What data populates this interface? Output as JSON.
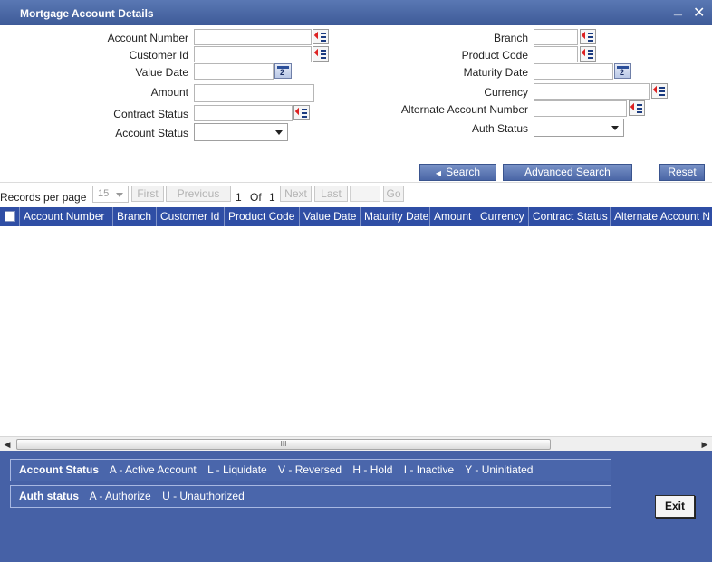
{
  "window": {
    "title": "Mortgage Account Details",
    "minimize": "_",
    "close": "✕"
  },
  "form": {
    "account_number": {
      "label": "Account Number",
      "value": ""
    },
    "customer_id": {
      "label": "Customer Id",
      "value": ""
    },
    "value_date": {
      "label": "Value Date",
      "value": ""
    },
    "amount": {
      "label": "Amount",
      "value": ""
    },
    "contract_status": {
      "label": "Contract Status",
      "value": ""
    },
    "account_status": {
      "label": "Account Status",
      "value": ""
    },
    "branch": {
      "label": "Branch",
      "value": ""
    },
    "product_code": {
      "label": "Product Code",
      "value": ""
    },
    "maturity_date": {
      "label": "Maturity Date",
      "value": ""
    },
    "currency": {
      "label": "Currency",
      "value": ""
    },
    "alternate_account_number": {
      "label": "Alternate Account Number",
      "value": ""
    },
    "auth_status": {
      "label": "Auth Status",
      "value": ""
    },
    "calendar_glyph": "2"
  },
  "actions": {
    "search": "Search",
    "advanced_search": "Advanced Search",
    "reset": "Reset"
  },
  "pager": {
    "records_per_page_label": "Records per page",
    "records_per_page": "15",
    "first": "First",
    "previous": "Previous",
    "current_page": "1",
    "of_label": "Of",
    "total_pages": "1",
    "next": "Next",
    "last": "Last",
    "go": "Go"
  },
  "grid": {
    "columns": [
      "Account Number",
      "Branch",
      "Customer Id",
      "Product Code",
      "Value Date",
      "Maturity Date",
      "Amount",
      "Currency",
      "Contract Status",
      "Alternate Account N"
    ]
  },
  "scrollbar": {
    "grip": "III"
  },
  "legend": {
    "account_status": {
      "title": "Account Status",
      "items": [
        "A - Active Account",
        "L - Liquidate",
        "V - Reversed",
        "H - Hold",
        "I - Inactive",
        "Y - Uninitiated"
      ]
    },
    "auth_status": {
      "title": "Auth status",
      "items": [
        "A - Authorize",
        "U - Unauthorized"
      ]
    }
  },
  "exit_label": "Exit",
  "colors": {
    "titlebar": "#3e5a98",
    "grid_header": "#2f4ea5",
    "footer": "#4661a6",
    "button": "#5a74b2"
  }
}
